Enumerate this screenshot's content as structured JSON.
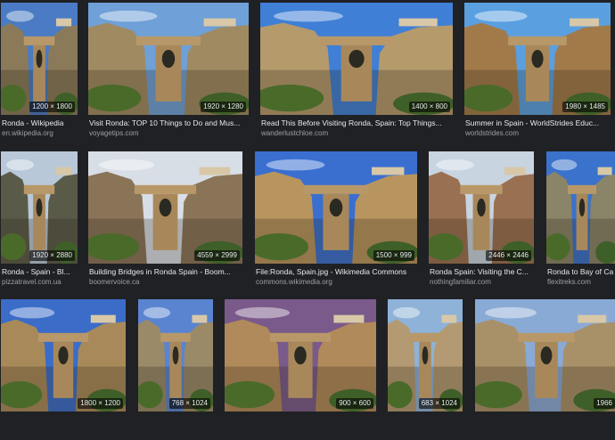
{
  "results": [
    {
      "title": "Ronda - Wikipedia",
      "source": "en.wikipedia.org",
      "dims": "1200 × 1800",
      "sky": "#4a7bc4",
      "rock": "#8a7a5a"
    },
    {
      "title": "Visit Ronda: TOP 10 Things to Do and Mus...",
      "source": "voyagetips.com",
      "dims": "1920 × 1280",
      "sky": "#6fa0d8",
      "rock": "#a08a62"
    },
    {
      "title": "Read This Before Visiting Ronda, Spain: Top Things...",
      "source": "wanderlustchloe.com",
      "dims": "1400 × 800",
      "sky": "#3f7fd6",
      "rock": "#b59a6c"
    },
    {
      "title": "Summer in Spain - WorldStrides Educ...",
      "source": "worldstrides.com",
      "dims": "1980 × 1485",
      "sky": "#5aa0e0",
      "rock": "#a27a4a"
    },
    {
      "title": "Ronda - Spain - Bl...",
      "source": "pizzatravel.com.ua",
      "dims": "1920 × 2880",
      "sky": "#b8c8d8",
      "rock": "#5a5a48"
    },
    {
      "title": "Building Bridges in Ronda Spain - Boom...",
      "source": "boomervoice.ca",
      "dims": "4559 × 2999",
      "sky": "#d8dee6",
      "rock": "#8a7458"
    },
    {
      "title": "File:Ronda, Spain.jpg - Wikimedia Commons",
      "source": "commons.wikimedia.org",
      "dims": "1500 × 999",
      "sky": "#3a6fd0",
      "rock": "#b8955e"
    },
    {
      "title": "Ronda Spain: Visiting the C...",
      "source": "nothingfamiliar.com",
      "dims": "2446 × 2446",
      "sky": "#c8d4e0",
      "rock": "#9a7052"
    },
    {
      "title": "Ronda to Bay of Ca",
      "source": "flexitreks.com",
      "dims": "",
      "sky": "#3a72cc",
      "rock": "#8a8468"
    },
    {
      "title": "",
      "source": "",
      "dims": "1800 × 1200",
      "sky": "#3b6cc8",
      "rock": "#a88a5a"
    },
    {
      "title": "",
      "source": "",
      "dims": "768 × 1024",
      "sky": "#5a84d0",
      "rock": "#9a8a68"
    },
    {
      "title": "",
      "source": "",
      "dims": "900 × 600",
      "sky": "#7a5a8a",
      "rock": "#b08a5a"
    },
    {
      "title": "",
      "source": "",
      "dims": "683 × 1024",
      "sky": "#8eb2d8",
      "rock": "#b39a72"
    },
    {
      "title": "",
      "source": "",
      "dims": "1966",
      "sky": "#8aaad6",
      "rock": "#a89068"
    }
  ]
}
